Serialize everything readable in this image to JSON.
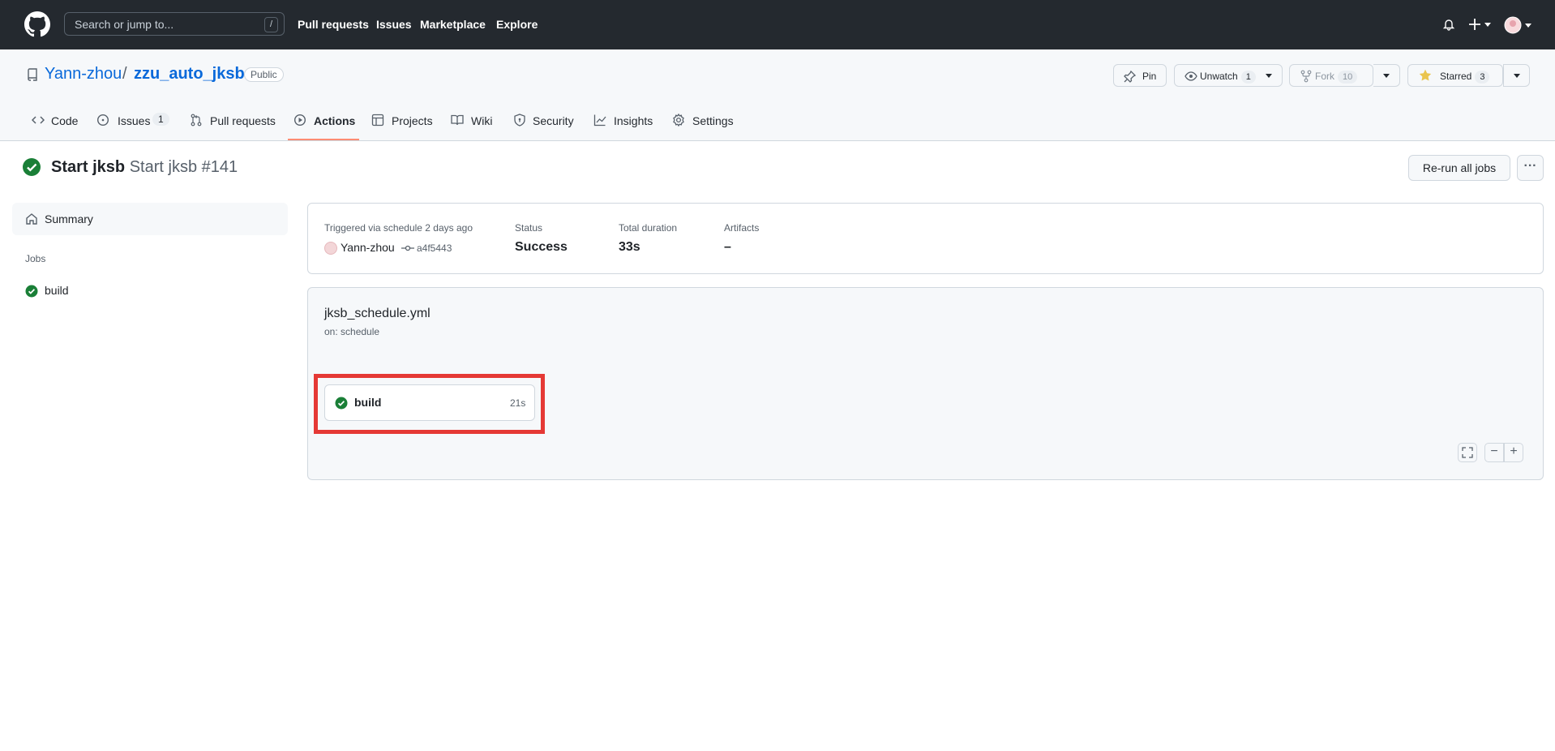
{
  "header": {
    "search_placeholder": "Search or jump to...",
    "search_shortcut": "/",
    "nav": [
      "Pull requests",
      "Issues",
      "Marketplace",
      "Explore"
    ],
    "icons": [
      "github-logo",
      "bell-icon",
      "plus-icon",
      "avatar"
    ]
  },
  "repo": {
    "owner": "Yann-zhou",
    "separator": "/",
    "name": "zzu_auto_jksb",
    "visibility": "Public",
    "pin_label": "Pin",
    "watch_label": "Unwatch",
    "watch_count": "1",
    "fork_label": "Fork",
    "fork_count": "10",
    "star_label": "Starred",
    "star_count": "3"
  },
  "tabs": {
    "code": "Code",
    "issues": "Issues",
    "issues_count": "1",
    "pulls": "Pull requests",
    "actions": "Actions",
    "projects": "Projects",
    "wiki": "Wiki",
    "security": "Security",
    "insights": "Insights",
    "settings": "Settings",
    "active": "Actions"
  },
  "run": {
    "workflow": "Start jksb",
    "title": "Start jksb #141",
    "rerun_label": "Re-run all jobs",
    "more_label": "···"
  },
  "sidebar": {
    "summary_label": "Summary",
    "jobs_heading": "Jobs",
    "jobs": [
      {
        "label": "build",
        "status": "success"
      }
    ]
  },
  "summary": {
    "trigger_label": "Triggered via schedule 2 days ago",
    "actor": "Yann-zhou",
    "commit": "a4f5443",
    "status_label": "Status",
    "status_value": "Success",
    "duration_label": "Total duration",
    "duration_value": "33s",
    "artifacts_label": "Artifacts",
    "artifacts_value": "–"
  },
  "graph": {
    "file": "jksb_schedule.yml",
    "trigger": "on: schedule",
    "job_label": "build",
    "job_duration": "21s",
    "fullscreen_icon": "fullscreen-icon",
    "zoom_out": "−",
    "zoom_in": "+"
  },
  "colors": {
    "header_bg": "#24292f",
    "link": "#0969da",
    "success": "#1a7f37",
    "tab_underline": "#fd8c73",
    "highlight": "#e53935"
  }
}
